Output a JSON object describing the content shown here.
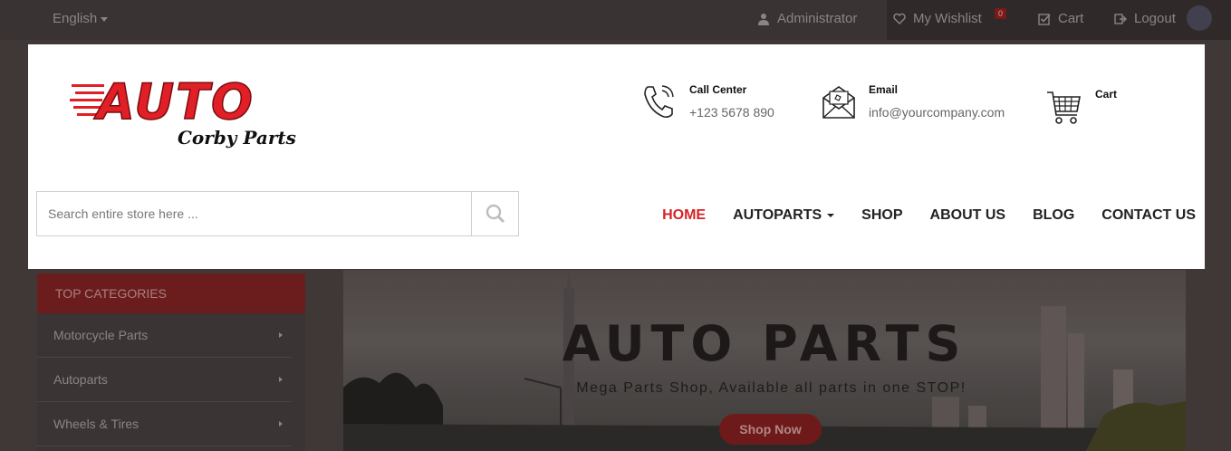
{
  "topbar": {
    "language": "English",
    "administrator": "Administrator",
    "wishlist": "My Wishlist",
    "wishlist_count": "0",
    "cart": "Cart",
    "logout": "Logout"
  },
  "header": {
    "logo_text": "AUTO",
    "logo_sub": "Corby Parts",
    "call": {
      "label": "Call Center",
      "value": "+123 5678 890"
    },
    "email": {
      "label": "Email",
      "value": "info@yourcompany.com"
    },
    "cart": {
      "label": "Cart"
    },
    "search": {
      "placeholder": "Search entire store here ...",
      "value": ""
    }
  },
  "nav": {
    "items": [
      "HOME",
      "AUTOPARTS",
      "SHOP",
      "ABOUT US",
      "BLOG",
      "CONTACT US"
    ],
    "active": "HOME"
  },
  "sidebar": {
    "title": "TOP CATEGORIES",
    "items": [
      "Motorcycle Parts",
      "Autoparts",
      "Wheels & Tires"
    ]
  },
  "banner": {
    "title": "AUTO PARTS",
    "subtitle": "Mega Parts Shop, Available all parts in one STOP!",
    "button": "Shop Now"
  },
  "colors": {
    "brand_red": "#d62327",
    "overlay": "#3f3837"
  }
}
